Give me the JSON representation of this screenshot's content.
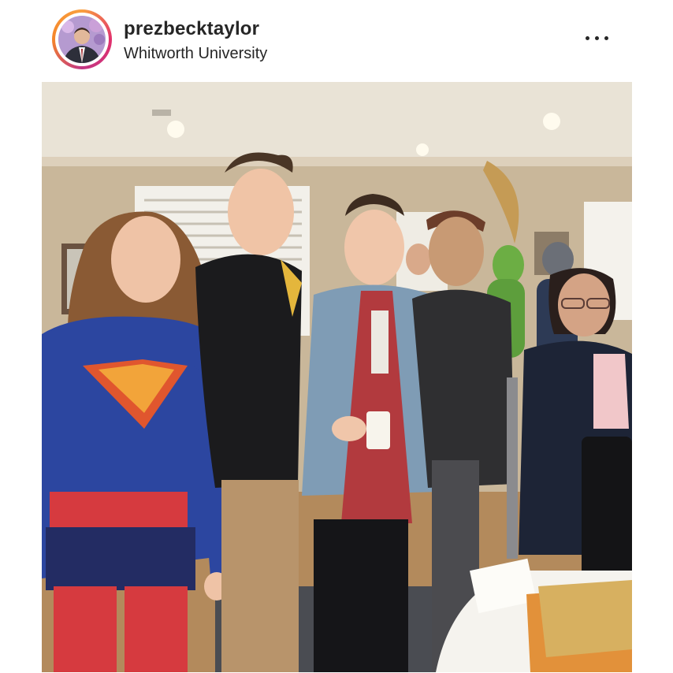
{
  "post": {
    "username": "prezbecktaylor",
    "location": "Whitworth University",
    "more_icon": "more-horizontal-icon",
    "avatar_icon": "profile-avatar",
    "photo_description_icon": "post-photo"
  },
  "colors": {
    "text": "#262626",
    "story_ring_start": "#f9a03f",
    "story_ring_end": "#c13584"
  }
}
